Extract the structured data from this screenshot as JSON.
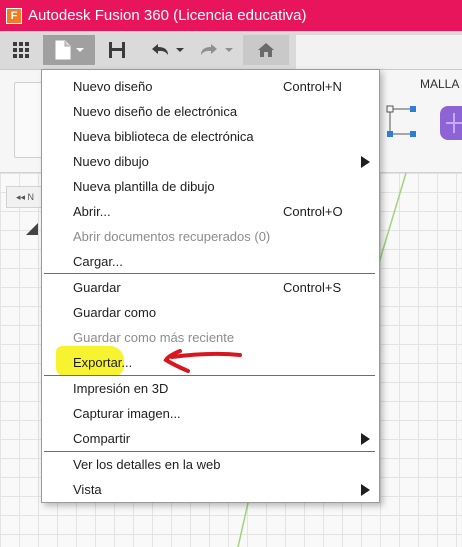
{
  "window": {
    "title": "Autodesk Fusion 360 (Licencia educativa)",
    "app_icon_glyph": "F"
  },
  "toolbar": {
    "icons": [
      "apps-grid-icon",
      "file-icon",
      "chevron-down-icon",
      "save-icon",
      "undo-icon",
      "redo-icon",
      "home-icon"
    ]
  },
  "ribbon": {
    "malla_label": "MALLA"
  },
  "canvas": {
    "browser_tab_label": "N"
  },
  "menu": {
    "items": [
      {
        "label": "Nuevo diseño",
        "shortcut": "Control+N"
      },
      {
        "label": "Nuevo diseño de electrónica"
      },
      {
        "label": "Nueva biblioteca de electrónica"
      },
      {
        "label": "Nuevo dibujo",
        "submenu": true
      },
      {
        "label": "Nueva plantilla de dibujo"
      },
      {
        "label": "Abrir...",
        "shortcut": "Control+O"
      },
      {
        "label": "Abrir documentos recuperados (0)",
        "disabled": true
      },
      {
        "label": "Cargar..."
      },
      {
        "label": "Guardar",
        "shortcut": "Control+S"
      },
      {
        "label": "Guardar como"
      },
      {
        "label": "Guardar como más reciente",
        "disabled": true
      },
      {
        "label": "Exportar..."
      },
      {
        "label": "Impresión en 3D"
      },
      {
        "label": "Capturar imagen..."
      },
      {
        "label": "Compartir",
        "submenu": true
      },
      {
        "label": "Ver los detalles en la web"
      },
      {
        "label": "Vista",
        "submenu": true
      }
    ]
  },
  "colors": {
    "titlebar": "#e8155d",
    "highlight": "#f6f21a",
    "annotation_arrow": "#d9161f"
  }
}
